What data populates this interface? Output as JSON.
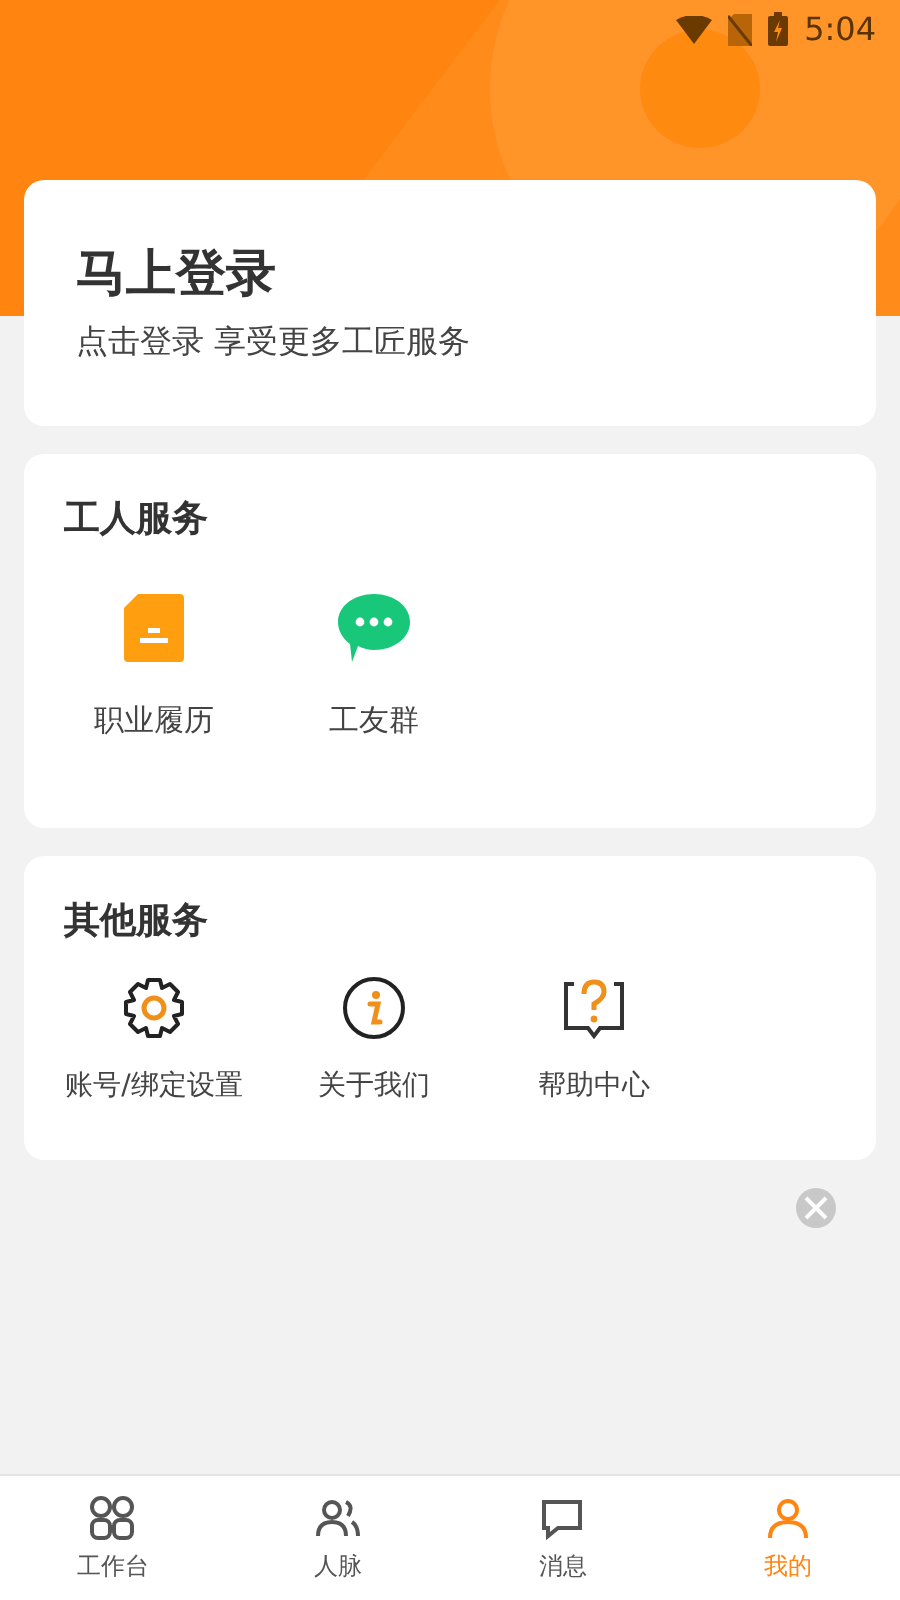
{
  "status_bar": {
    "time": "5:04"
  },
  "login_card": {
    "title": "马上登录",
    "subtitle": "点击登录 享受更多工匠服务"
  },
  "sections": [
    {
      "title": "工人服务",
      "items": [
        {
          "label": "职业履历",
          "kind": "resume"
        },
        {
          "label": "工友群",
          "kind": "chat"
        }
      ]
    },
    {
      "title": "其他服务",
      "items": [
        {
          "label": "账号/绑定设置",
          "kind": "settings"
        },
        {
          "label": "关于我们",
          "kind": "info"
        },
        {
          "label": "帮助中心",
          "kind": "help"
        }
      ]
    }
  ],
  "tabs": [
    {
      "label": "工作台",
      "kind": "grid",
      "selected": false
    },
    {
      "label": "人脉",
      "kind": "people",
      "selected": false
    },
    {
      "label": "消息",
      "kind": "message",
      "selected": false
    },
    {
      "label": "我的",
      "kind": "user",
      "selected": true
    }
  ]
}
